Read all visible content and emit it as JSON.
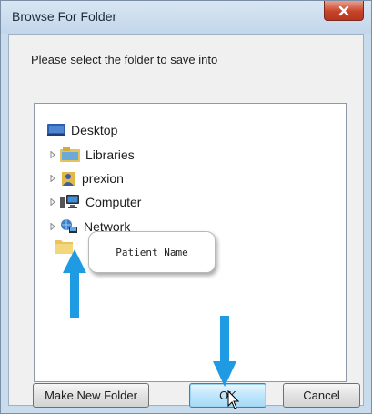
{
  "window": {
    "title": "Browse For Folder",
    "close_glyph": "x"
  },
  "instruction": "Please select the folder to save into",
  "tree": {
    "items": [
      {
        "label": "Desktop",
        "icon": "desktop-icon",
        "expandable": false
      },
      {
        "label": "Libraries",
        "icon": "libraries-icon",
        "expandable": true
      },
      {
        "label": "prexion",
        "icon": "user-folder-icon",
        "expandable": true
      },
      {
        "label": "Computer",
        "icon": "computer-icon",
        "expandable": true
      },
      {
        "label": "Network",
        "icon": "network-icon",
        "expandable": true
      },
      {
        "label": "",
        "icon": "folder-icon",
        "expandable": false
      }
    ]
  },
  "tooltip": {
    "text": "Patient Name"
  },
  "buttons": {
    "make_new_folder": "Make New Folder",
    "ok": "OK",
    "cancel": "Cancel"
  },
  "colors": {
    "annotation_arrow": "#1e9be3",
    "close_button": "#c7432a",
    "window_frame": "#c9dced"
  }
}
